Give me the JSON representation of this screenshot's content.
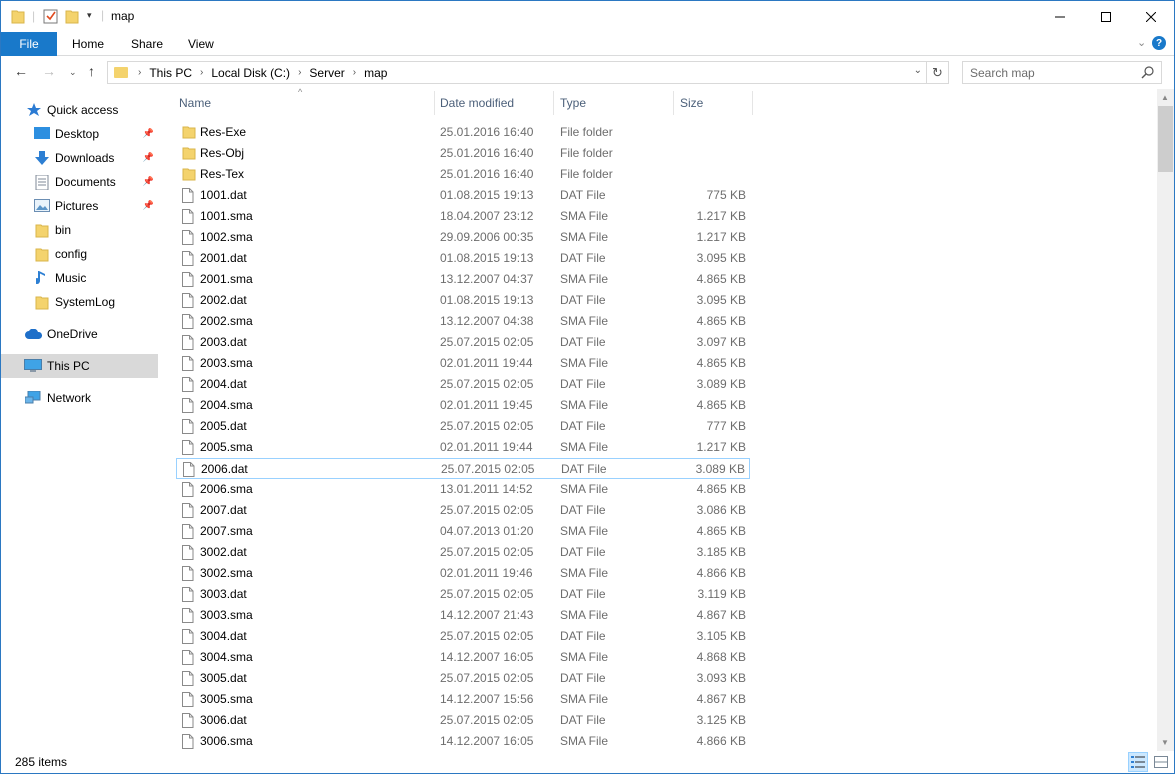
{
  "window": {
    "title": "map"
  },
  "ribbon": {
    "tabs": [
      "File",
      "Home",
      "Share",
      "View"
    ]
  },
  "address": {
    "crumbs": [
      "This PC",
      "Local Disk (C:)",
      "Server",
      "map"
    ]
  },
  "search": {
    "placeholder": "Search map"
  },
  "navpane": {
    "items": [
      {
        "label": "Quick access",
        "icon": "star-icon"
      },
      {
        "label": "Desktop",
        "icon": "desktop-icon",
        "pinned": true
      },
      {
        "label": "Downloads",
        "icon": "download-icon",
        "pinned": true
      },
      {
        "label": "Documents",
        "icon": "documents-icon",
        "pinned": true
      },
      {
        "label": "Pictures",
        "icon": "pictures-icon",
        "pinned": true
      },
      {
        "label": "bin",
        "icon": "folder-icon"
      },
      {
        "label": "config",
        "icon": "folder-icon"
      },
      {
        "label": "Music",
        "icon": "music-icon"
      },
      {
        "label": "SystemLog",
        "icon": "folder-icon"
      },
      {
        "label": "OneDrive",
        "icon": "cloud-icon"
      },
      {
        "label": "This PC",
        "icon": "computer-icon",
        "selected": true
      },
      {
        "label": "Network",
        "icon": "network-icon"
      }
    ]
  },
  "columns": {
    "name": "Name",
    "date": "Date modified",
    "type": "Type",
    "size": "Size"
  },
  "files": [
    {
      "name": "Res-Exe",
      "date": "25.01.2016 16:40",
      "type": "File folder",
      "size": "",
      "kind": "folder"
    },
    {
      "name": "Res-Obj",
      "date": "25.01.2016 16:40",
      "type": "File folder",
      "size": "",
      "kind": "folder"
    },
    {
      "name": "Res-Tex",
      "date": "25.01.2016 16:40",
      "type": "File folder",
      "size": "",
      "kind": "folder"
    },
    {
      "name": "1001.dat",
      "date": "01.08.2015 19:13",
      "type": "DAT File",
      "size": "775 KB",
      "kind": "file"
    },
    {
      "name": "1001.sma",
      "date": "18.04.2007 23:12",
      "type": "SMA File",
      "size": "1.217 KB",
      "kind": "file"
    },
    {
      "name": "1002.sma",
      "date": "29.09.2006 00:35",
      "type": "SMA File",
      "size": "1.217 KB",
      "kind": "file"
    },
    {
      "name": "2001.dat",
      "date": "01.08.2015 19:13",
      "type": "DAT File",
      "size": "3.095 KB",
      "kind": "file"
    },
    {
      "name": "2001.sma",
      "date": "13.12.2007 04:37",
      "type": "SMA File",
      "size": "4.865 KB",
      "kind": "file"
    },
    {
      "name": "2002.dat",
      "date": "01.08.2015 19:13",
      "type": "DAT File",
      "size": "3.095 KB",
      "kind": "file"
    },
    {
      "name": "2002.sma",
      "date": "13.12.2007 04:38",
      "type": "SMA File",
      "size": "4.865 KB",
      "kind": "file"
    },
    {
      "name": "2003.dat",
      "date": "25.07.2015 02:05",
      "type": "DAT File",
      "size": "3.097 KB",
      "kind": "file"
    },
    {
      "name": "2003.sma",
      "date": "02.01.2011 19:44",
      "type": "SMA File",
      "size": "4.865 KB",
      "kind": "file"
    },
    {
      "name": "2004.dat",
      "date": "25.07.2015 02:05",
      "type": "DAT File",
      "size": "3.089 KB",
      "kind": "file"
    },
    {
      "name": "2004.sma",
      "date": "02.01.2011 19:45",
      "type": "SMA File",
      "size": "4.865 KB",
      "kind": "file"
    },
    {
      "name": "2005.dat",
      "date": "25.07.2015 02:05",
      "type": "DAT File",
      "size": "777 KB",
      "kind": "file"
    },
    {
      "name": "2005.sma",
      "date": "02.01.2011 19:44",
      "type": "SMA File",
      "size": "1.217 KB",
      "kind": "file"
    },
    {
      "name": "2006.dat",
      "date": "25.07.2015 02:05",
      "type": "DAT File",
      "size": "3.089 KB",
      "kind": "file",
      "focused": true
    },
    {
      "name": "2006.sma",
      "date": "13.01.2011 14:52",
      "type": "SMA File",
      "size": "4.865 KB",
      "kind": "file"
    },
    {
      "name": "2007.dat",
      "date": "25.07.2015 02:05",
      "type": "DAT File",
      "size": "3.086 KB",
      "kind": "file"
    },
    {
      "name": "2007.sma",
      "date": "04.07.2013 01:20",
      "type": "SMA File",
      "size": "4.865 KB",
      "kind": "file"
    },
    {
      "name": "3002.dat",
      "date": "25.07.2015 02:05",
      "type": "DAT File",
      "size": "3.185 KB",
      "kind": "file"
    },
    {
      "name": "3002.sma",
      "date": "02.01.2011 19:46",
      "type": "SMA File",
      "size": "4.866 KB",
      "kind": "file"
    },
    {
      "name": "3003.dat",
      "date": "25.07.2015 02:05",
      "type": "DAT File",
      "size": "3.119 KB",
      "kind": "file"
    },
    {
      "name": "3003.sma",
      "date": "14.12.2007 21:43",
      "type": "SMA File",
      "size": "4.867 KB",
      "kind": "file"
    },
    {
      "name": "3004.dat",
      "date": "25.07.2015 02:05",
      "type": "DAT File",
      "size": "3.105 KB",
      "kind": "file"
    },
    {
      "name": "3004.sma",
      "date": "14.12.2007 16:05",
      "type": "SMA File",
      "size": "4.868 KB",
      "kind": "file"
    },
    {
      "name": "3005.dat",
      "date": "25.07.2015 02:05",
      "type": "DAT File",
      "size": "3.093 KB",
      "kind": "file"
    },
    {
      "name": "3005.sma",
      "date": "14.12.2007 15:56",
      "type": "SMA File",
      "size": "4.867 KB",
      "kind": "file"
    },
    {
      "name": "3006.dat",
      "date": "25.07.2015 02:05",
      "type": "DAT File",
      "size": "3.125 KB",
      "kind": "file"
    },
    {
      "name": "3006.sma",
      "date": "14.12.2007 16:05",
      "type": "SMA File",
      "size": "4.866 KB",
      "kind": "file"
    }
  ],
  "status": {
    "items_count": "285 items"
  },
  "colors": {
    "accent": "#1979ca",
    "folder": "#f4d36d",
    "selection": "#d9d9d9",
    "focus_border": "#99d1ff"
  }
}
